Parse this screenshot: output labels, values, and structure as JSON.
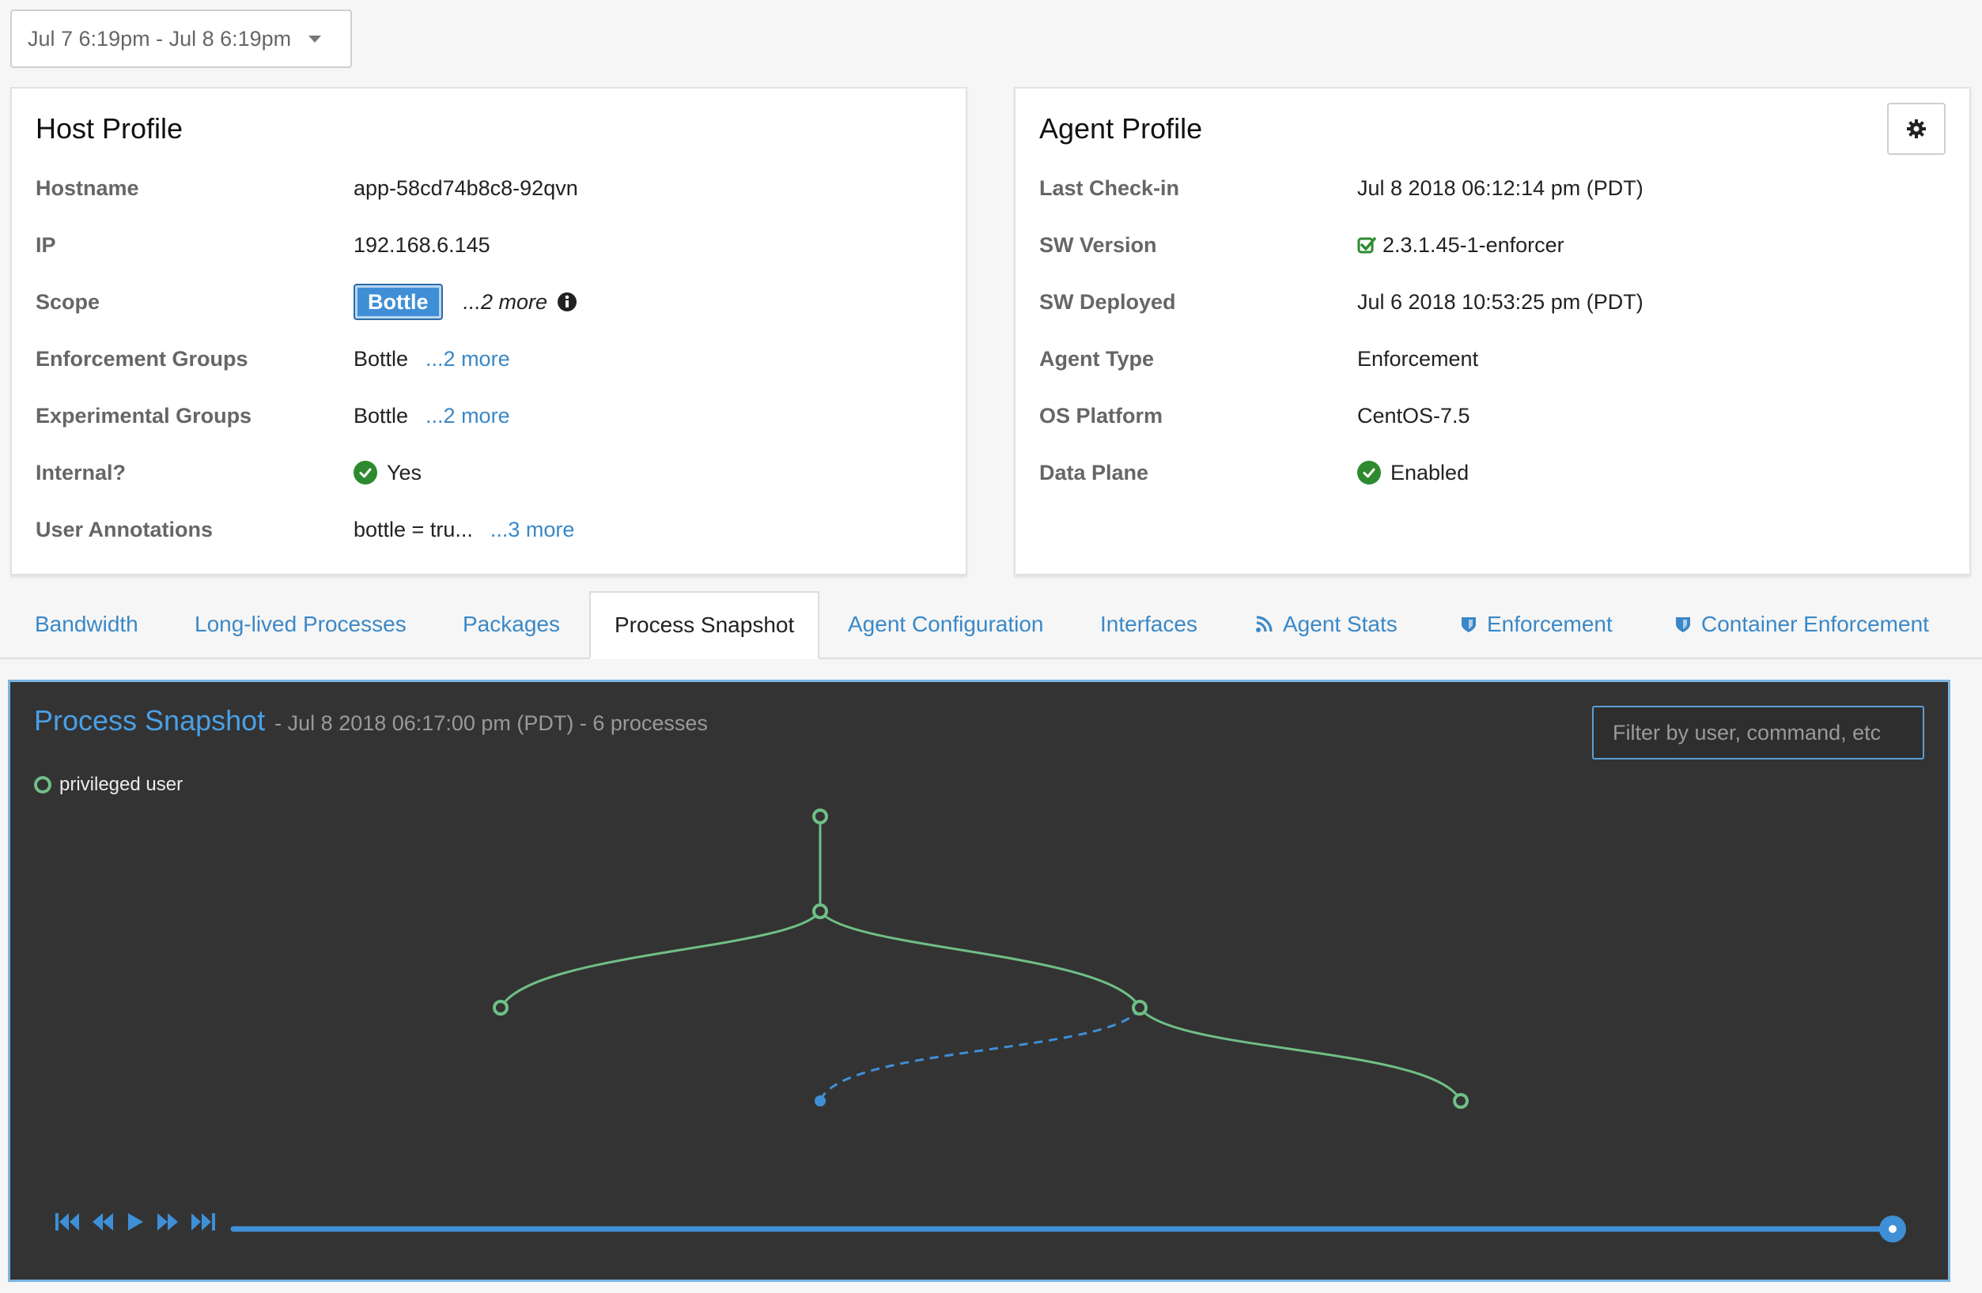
{
  "date_range": {
    "label": "Jul 7 6:19pm - Jul 8 6:19pm"
  },
  "host_profile": {
    "title": "Host Profile",
    "rows": [
      {
        "key": "Hostname",
        "value": "app-58cd74b8c8-92qvn"
      },
      {
        "key": "IP",
        "value": "192.168.6.145"
      },
      {
        "key": "Scope",
        "value": "Bottle",
        "more": "...2 more"
      },
      {
        "key": "Enforcement Groups",
        "value": "Bottle",
        "more": "...2 more"
      },
      {
        "key": "Experimental Groups",
        "value": "Bottle",
        "more": "...2 more"
      },
      {
        "key": "Internal?",
        "value": "Yes"
      },
      {
        "key": "User Annotations",
        "value": "bottle = tru...",
        "more": "...3 more"
      }
    ]
  },
  "agent_profile": {
    "title": "Agent Profile",
    "rows": [
      {
        "key": "Last Check-in",
        "value": "Jul 8 2018 06:12:14 pm (PDT)"
      },
      {
        "key": "SW Version",
        "value": "2.3.1.45-1-enforcer"
      },
      {
        "key": "SW Deployed",
        "value": "Jul 6 2018 10:53:25 pm (PDT)"
      },
      {
        "key": "Agent Type",
        "value": "Enforcement"
      },
      {
        "key": "OS Platform",
        "value": "CentOS-7.5"
      },
      {
        "key": "Data Plane",
        "value": "Enabled"
      }
    ]
  },
  "tabs": [
    {
      "label": "Bandwidth"
    },
    {
      "label": "Long-lived Processes"
    },
    {
      "label": "Packages"
    },
    {
      "label": "Process Snapshot",
      "active": true
    },
    {
      "label": "Agent Configuration"
    },
    {
      "label": "Interfaces"
    },
    {
      "label": "Agent Stats",
      "icon": "rss-icon"
    },
    {
      "label": "Enforcement",
      "icon": "shield-icon"
    },
    {
      "label": "Container Enforcement",
      "icon": "shield-icon"
    }
  ],
  "process_snapshot": {
    "title": "Process Snapshot",
    "subtitle": "- Jul 8 2018 06:17:00 pm (PDT) - 6 processes",
    "filter_placeholder": "Filter by user, command, etc",
    "legend": "privileged user",
    "playback_progress": 1.0
  },
  "colors": {
    "link": "#3a88c7",
    "accent": "#4aa0e6",
    "privileged_node": "#6fbf86",
    "normal_node": "#3f8fd6",
    "panel_bg": "#333333",
    "check_green": "#2e8a2e"
  }
}
